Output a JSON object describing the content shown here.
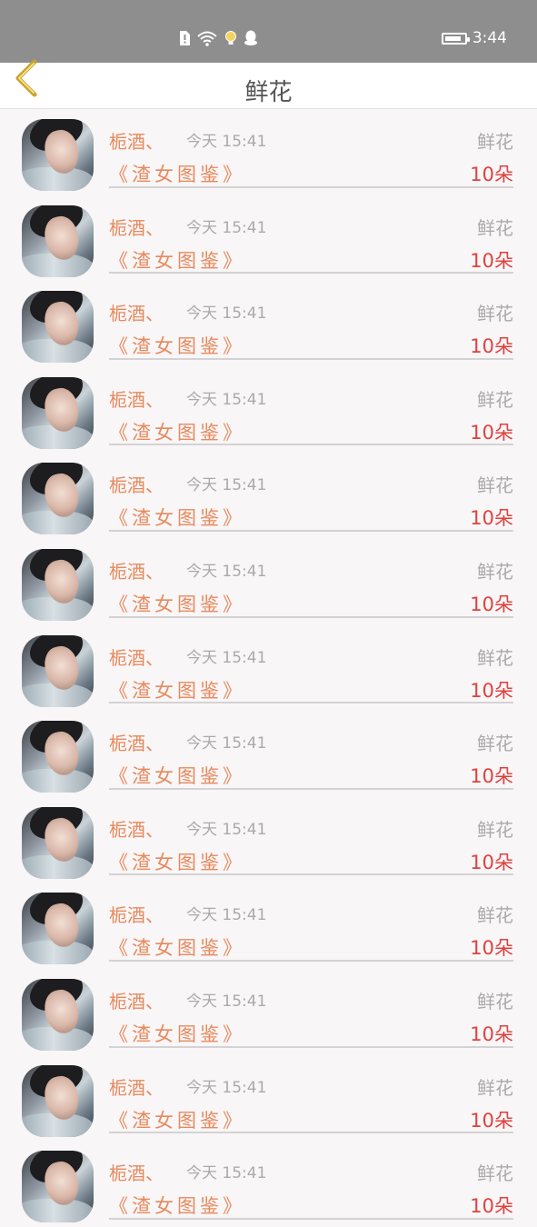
{
  "status_bar": {
    "time": "3:44",
    "icons": [
      "sim-alert-icon",
      "wifi-icon",
      "bulb-icon",
      "qq-icon"
    ],
    "battery_level": 0.85
  },
  "header": {
    "title": "鲜花",
    "back_icon": "chevron-left-icon"
  },
  "colors": {
    "accent_orange": "#e8895d",
    "count_red": "#e0413e",
    "meta_gray": "#aaaaaa"
  },
  "records": [
    {
      "nick": "栀酒、",
      "time": "今天 15:41",
      "gift": "鲜花",
      "book": "《渣女图鉴》",
      "count": "10朵"
    },
    {
      "nick": "栀酒、",
      "time": "今天 15:41",
      "gift": "鲜花",
      "book": "《渣女图鉴》",
      "count": "10朵"
    },
    {
      "nick": "栀酒、",
      "time": "今天 15:41",
      "gift": "鲜花",
      "book": "《渣女图鉴》",
      "count": "10朵"
    },
    {
      "nick": "栀酒、",
      "time": "今天 15:41",
      "gift": "鲜花",
      "book": "《渣女图鉴》",
      "count": "10朵"
    },
    {
      "nick": "栀酒、",
      "time": "今天 15:41",
      "gift": "鲜花",
      "book": "《渣女图鉴》",
      "count": "10朵"
    },
    {
      "nick": "栀酒、",
      "time": "今天 15:41",
      "gift": "鲜花",
      "book": "《渣女图鉴》",
      "count": "10朵"
    },
    {
      "nick": "栀酒、",
      "time": "今天 15:41",
      "gift": "鲜花",
      "book": "《渣女图鉴》",
      "count": "10朵"
    },
    {
      "nick": "栀酒、",
      "time": "今天 15:41",
      "gift": "鲜花",
      "book": "《渣女图鉴》",
      "count": "10朵"
    },
    {
      "nick": "栀酒、",
      "time": "今天 15:41",
      "gift": "鲜花",
      "book": "《渣女图鉴》",
      "count": "10朵"
    },
    {
      "nick": "栀酒、",
      "time": "今天 15:41",
      "gift": "鲜花",
      "book": "《渣女图鉴》",
      "count": "10朵"
    },
    {
      "nick": "栀酒、",
      "time": "今天 15:41",
      "gift": "鲜花",
      "book": "《渣女图鉴》",
      "count": "10朵"
    },
    {
      "nick": "栀酒、",
      "time": "今天 15:41",
      "gift": "鲜花",
      "book": "《渣女图鉴》",
      "count": "10朵"
    },
    {
      "nick": "栀酒、",
      "time": "今天 15:41",
      "gift": "鲜花",
      "book": "《渣女图鉴》",
      "count": "10朵"
    }
  ]
}
